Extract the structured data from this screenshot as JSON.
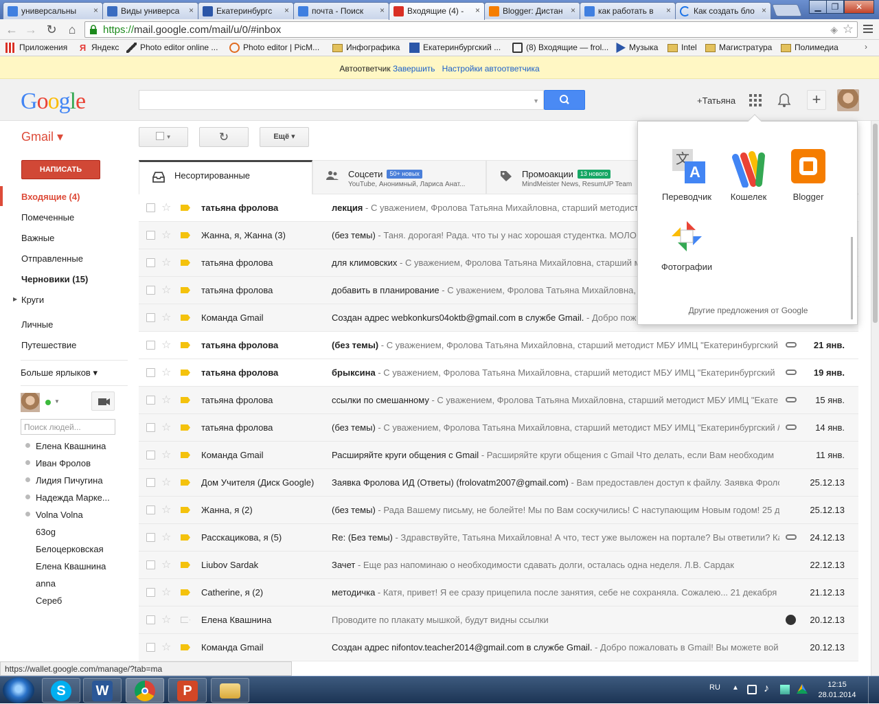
{
  "browser": {
    "tabs": [
      {
        "label": "универсальны",
        "fav": "#3f7fe0"
      },
      {
        "label": "Виды универса",
        "fav": "#3a6cc0"
      },
      {
        "label": "Екатеринбургс",
        "fav": "#2b56a8"
      },
      {
        "label": "почта - Поиск",
        "fav": "#3f7fe0"
      },
      {
        "label": "Входящие (4) -",
        "fav": "#d93025"
      },
      {
        "label": "Blogger: Дистан",
        "fav": "#f57d00"
      },
      {
        "label": "как работать в",
        "fav": "#3f7fe0"
      },
      {
        "label": "Как создать бло",
        "fav": "#1a73e8"
      }
    ],
    "url_scheme": "https://",
    "url_rest": "mail.google.com/mail/u/0/#inbox",
    "bookmarks": [
      {
        "label": "Приложения",
        "color": "#d93025"
      },
      {
        "label": "Яндекс",
        "color": "#e53935"
      },
      {
        "label": "Photo editor online ...",
        "color": "#222"
      },
      {
        "label": "Photo editor | PicM...",
        "color": "#e06a1f"
      },
      {
        "label": "Инфографика",
        "color": "#e3c15c"
      },
      {
        "label": "Екатеринбургский ...",
        "color": "#2b56a8"
      },
      {
        "label": "(8) Входящие — frol...",
        "color": "#333"
      },
      {
        "label": "Музыка",
        "color": "#2b56a8"
      },
      {
        "label": "Intel",
        "color": "#e3c15c"
      },
      {
        "label": "Магистратура",
        "color": "#e3c15c"
      },
      {
        "label": "Полимедиа",
        "color": "#e3c15c"
      }
    ]
  },
  "vacation": {
    "label": "Автоответчик",
    "end": "Завершить",
    "settings": "Настройки автоответчика"
  },
  "header": {
    "user": "+Татьяна"
  },
  "toolbar": {
    "gmail": "Gmail ▾",
    "more": "Ещё ▾",
    "compose": "НАПИСАТЬ"
  },
  "nav": [
    {
      "label": "Входящие (4)"
    },
    {
      "label": "Помеченные"
    },
    {
      "label": "Важные"
    },
    {
      "label": "Отправленные"
    },
    {
      "label": "Черновики (15)"
    },
    {
      "label": "Круги"
    },
    {
      "label": "Личные"
    },
    {
      "label": "Путешествие"
    },
    {
      "label": "Больше ярлыков ▾"
    }
  ],
  "chat": {
    "search_placeholder": "Поиск людей...",
    "contacts": [
      "Елена Квашнина",
      "Иван Фролов",
      "Лидия Пичугина",
      "Надежда Марке...",
      "Volna Volna",
      "63og",
      "Белоцерковская",
      "Елена Квашнина",
      "anna",
      "Сереб"
    ]
  },
  "inbox_tabs": [
    {
      "label": "Несортированные",
      "sub": "",
      "badge": ""
    },
    {
      "label": "Соцсети",
      "sub": "YouTube, Анонимный, Лариса Анат...",
      "badge": "50+ новых",
      "badge_color": "#4a7fd9"
    },
    {
      "label": "Промоакции",
      "sub": "MindMeister News, ResumUP Team",
      "badge": "13 нового",
      "badge_color": "#16a765"
    }
  ],
  "emails": [
    {
      "from": "татьяна фролова",
      "subject": "лекция",
      "snippet": " - С уважением, Фролова Татьяна Михайловна, старший методист",
      "date": "",
      "unread": true,
      "clip": false
    },
    {
      "from": "Жанна, я, Жанна (3)",
      "subject": "(без темы)",
      "snippet": " - Таня. дорогая! Рада. что ты у нас хорошая студентка. МОЛО",
      "date": "",
      "unread": false,
      "clip": false
    },
    {
      "from": "татьяна фролова",
      "subject": "для климовских",
      "snippet": " - С уважением, Фролова Татьяна Михайловна, старший м",
      "date": "",
      "unread": false,
      "clip": false
    },
    {
      "from": "татьяна фролова",
      "subject": "добавить в планирование",
      "snippet": " - С уважением, Фролова Татьяна Михайловна,",
      "date": "",
      "unread": false,
      "clip": false
    },
    {
      "from": "Команда Gmail",
      "subject": "Создан адрес webkonkurs04oktb@gmail.com в службе Gmail.",
      "snippet": " - Добро пож",
      "date": "",
      "unread": false,
      "clip": false
    },
    {
      "from": "татьяна фролова",
      "subject": "(без темы)",
      "snippet": " - С уважением, Фролова Татьяна Михайловна, старший методист МБУ ИМЦ \"Екатеринбургский",
      "date": "21 янв.",
      "unread": true,
      "clip": true
    },
    {
      "from": "татьяна фролова",
      "subject": "брыксина",
      "snippet": " - С уважением, Фролова Татьяна Михайловна, старший методист МБУ ИМЦ \"Екатеринбургский",
      "date": "19 янв.",
      "unread": true,
      "clip": true
    },
    {
      "from": "татьяна фролова",
      "subject": "ссылки по смешанному",
      "snippet": " - С уважением, Фролова Татьяна Михайловна, старший методист МБУ ИМЦ \"Екате",
      "date": "15 янв.",
      "unread": false,
      "clip": true
    },
    {
      "from": "татьяна фролова",
      "subject": "(без темы)",
      "snippet": " - С уважением, Фролова Татьяна Михайловна, старший методист МБУ ИМЦ \"Екатеринбургский /",
      "date": "14 янв.",
      "unread": false,
      "clip": true
    },
    {
      "from": "Команда Gmail",
      "subject": "Расширяйте круги общения с Gmail",
      "snippet": " - Расширяйте круги общения с Gmail Что делать, если Вам необходим",
      "date": "11 янв.",
      "unread": false,
      "clip": false
    },
    {
      "from": "Дом Учителя (Диск Google)",
      "subject": "Заявка Фролова ИД (Ответы) (frolovatm2007@gmail.com)",
      "snippet": " - Вам предоставлен доступ к файлу. Заявка Фроло",
      "date": "25.12.13",
      "unread": false,
      "clip": false
    },
    {
      "from": "Жанна, я (2)",
      "subject": "(без темы)",
      "snippet": " - Рада Вашему письму, не болейте! Мы по Вам соскучились! С наступающим Новым годом! 25 д",
      "date": "25.12.13",
      "unread": false,
      "clip": false
    },
    {
      "from": "Расскацикова, я (5)",
      "subject": "Re: (Без темы)",
      "snippet": " - Здравствуйте, Татьяна Михайловна! А что, тест уже выложен на портале? Вы ответили? Ка",
      "date": "24.12.13",
      "unread": false,
      "clip": true
    },
    {
      "from": "Liubov Sardak",
      "subject": "Зачет",
      "snippet": " - Еще раз напоминаю о необходимости сдавать долги, осталась одна неделя. Л.В. Сардак",
      "date": "22.12.13",
      "unread": false,
      "clip": false
    },
    {
      "from": "Catherine, я (2)",
      "subject": "методичка",
      "snippet": " - Катя, привет! Я ее сразу прицепила после занятия, себе не сохраняла. Сожалею... 21 декабря 2",
      "date": "21.12.13",
      "unread": false,
      "clip": false
    },
    {
      "from": "Елена Квашнина",
      "subject": "",
      "snippet": "Проводите по плакату мышкой, будут видны ссылки",
      "date": "20.12.13",
      "unread": false,
      "clip": false,
      "hangout": true
    },
    {
      "from": "Команда Gmail",
      "subject": "Создан адрес nifontov.teacher2014@gmail.com в службе Gmail.",
      "snippet": " - Добро пожаловать в Gmail! Вы можете вой",
      "date": "20.12.13",
      "unread": false,
      "clip": false
    }
  ],
  "apps_popup": {
    "apps": [
      {
        "label": "Переводчик"
      },
      {
        "label": "Кошелек"
      },
      {
        "label": "Blogger"
      },
      {
        "label": "Фотографии"
      }
    ],
    "more": "Другие предложения от Google"
  },
  "status_url": "https://wallet.google.com/manage/?tab=ma",
  "taskbar": {
    "lang": "RU",
    "time": "12:15",
    "date": "28.01.2014"
  }
}
